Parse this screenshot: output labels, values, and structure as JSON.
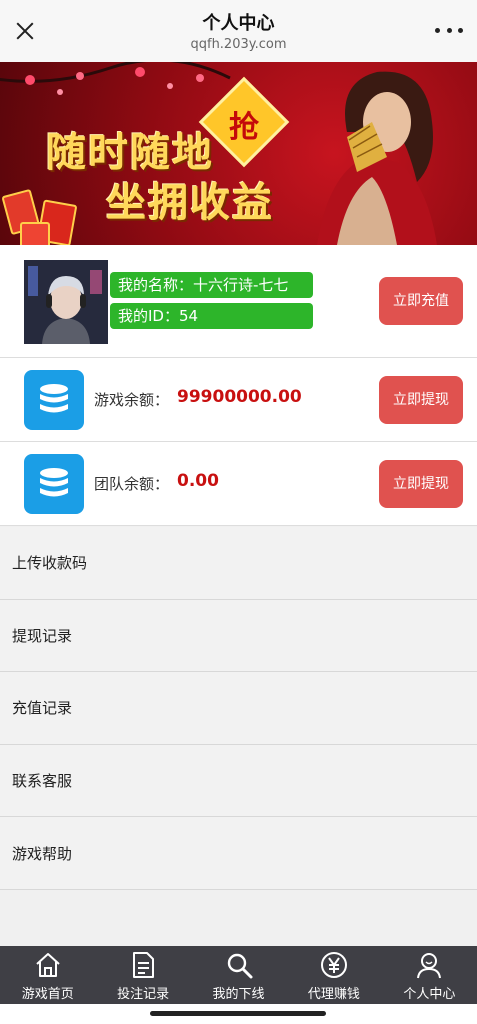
{
  "header": {
    "title": "个人中心",
    "url": "qqfh.203y.com"
  },
  "banner": {
    "line1": "随时随地",
    "line2": "坐拥收益",
    "badge": "抢"
  },
  "profile": {
    "name_label": "我的名称：十六行诗-七七",
    "id_label": "我的ID：54",
    "recharge_button": "立即充值"
  },
  "balances": [
    {
      "label": "游戏余额：",
      "value": "99900000.00",
      "button": "立即提现"
    },
    {
      "label": "团队余额：",
      "value": "0.00",
      "button": "立即提现"
    }
  ],
  "menu": [
    {
      "label": "上传收款码"
    },
    {
      "label": "提现记录"
    },
    {
      "label": "充值记录"
    },
    {
      "label": "联系客服"
    },
    {
      "label": "游戏帮助"
    }
  ],
  "nav": [
    {
      "label": "游戏首页",
      "icon": "home-icon"
    },
    {
      "label": "投注记录",
      "icon": "document-icon"
    },
    {
      "label": "我的下线",
      "icon": "search-icon"
    },
    {
      "label": "代理赚钱",
      "icon": "yen-icon"
    },
    {
      "label": "个人中心",
      "icon": "user-icon"
    }
  ],
  "colors": {
    "accent_red": "#e0524f",
    "tag_green": "#2db52a",
    "coin_blue": "#1b9ee6",
    "value_red": "#c81010",
    "nav_bg": "#3f3f45"
  }
}
